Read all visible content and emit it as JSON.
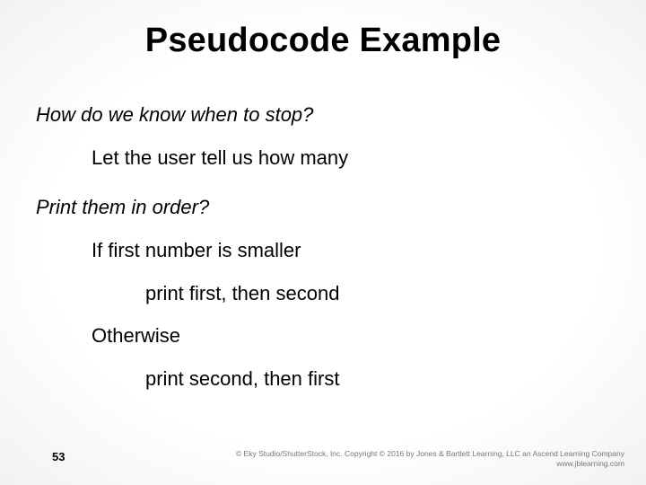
{
  "title": "Pseudocode Example",
  "body": {
    "q1": "How do we know when to stop?",
    "a1": "Let the user tell us how many",
    "q2": "Print them in order?",
    "a2_line1": "If first number is smaller",
    "a2_line2": "print first, then second",
    "a2_line3": "Otherwise",
    "a2_line4": "print second, then first"
  },
  "page_number": "53",
  "copyright": {
    "line1": "© Eky Studio/ShutterStock, Inc. Copyright © 2016 by Jones & Bartlett Learning, LLC an Ascend Learning Company",
    "line2": "www.jblearning.com"
  }
}
